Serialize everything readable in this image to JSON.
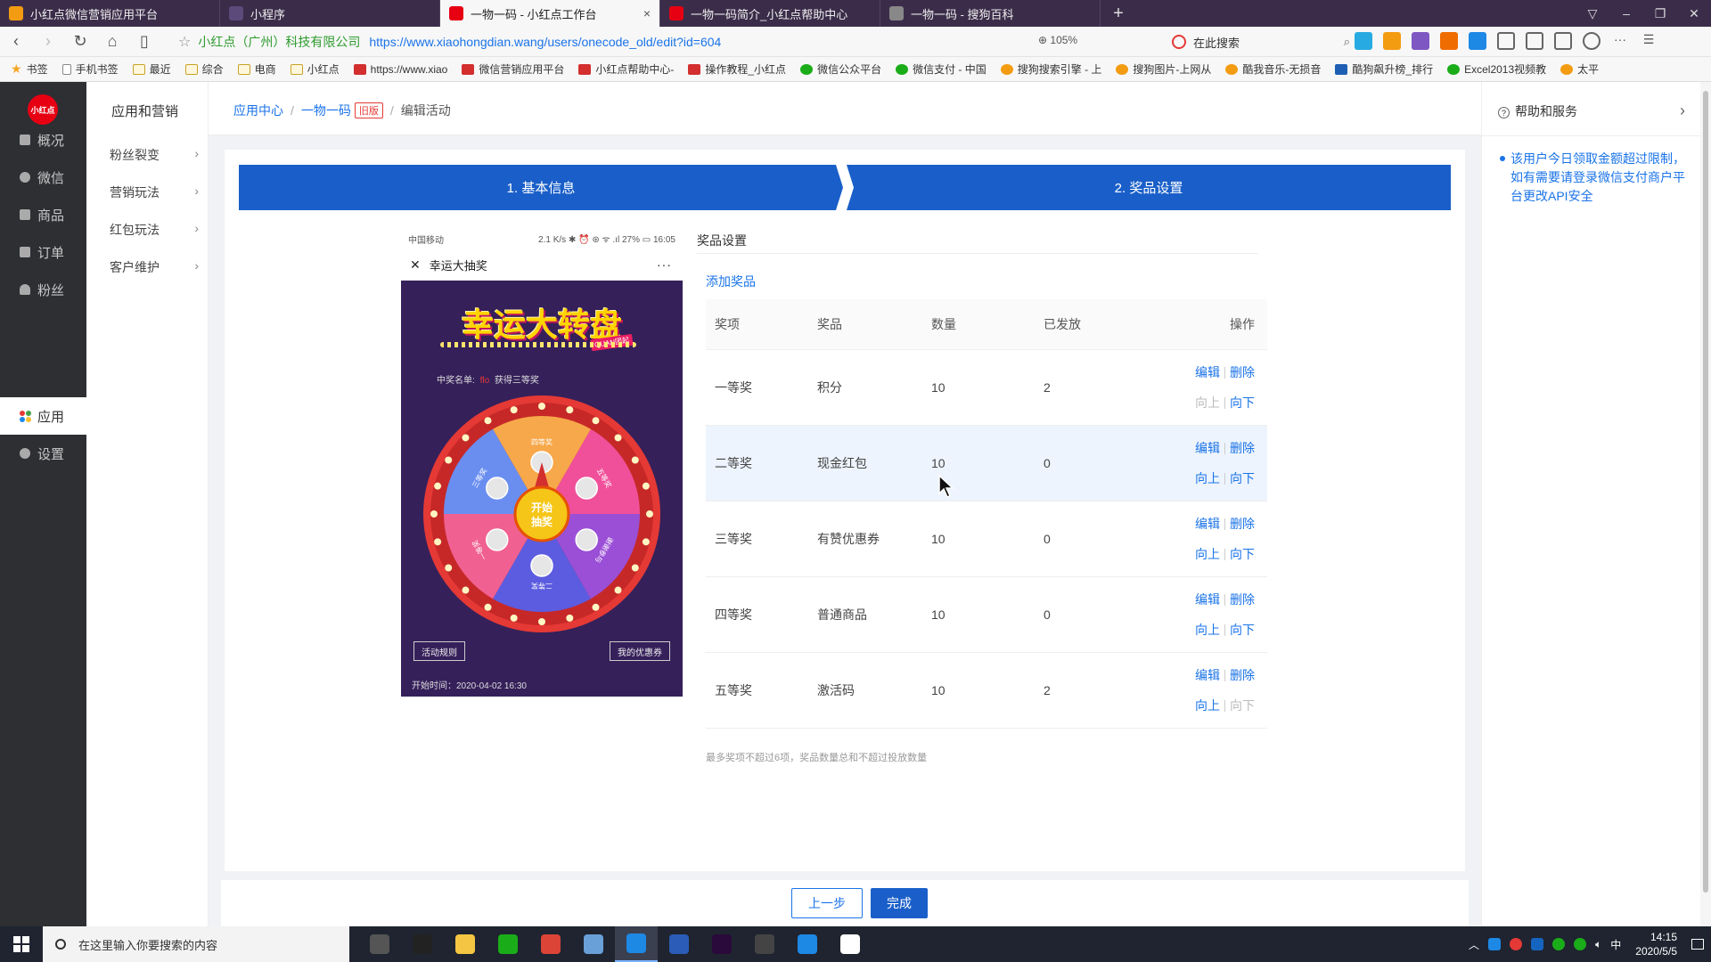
{
  "browser": {
    "tabs": [
      {
        "title": "小红点微信营销应用平台",
        "active": false,
        "icon": "monkey-icon",
        "color": "#f39c12"
      },
      {
        "title": "小程序",
        "active": false,
        "icon": "mini-program-icon",
        "color": "#5b4a7a"
      },
      {
        "title": "一物一码 - 小红点工作台",
        "active": true,
        "icon": "xiaohongdian-icon",
        "color": "#e60012"
      },
      {
        "title": "一物一码简介_小红点帮助中心",
        "active": false,
        "icon": "xiaohongdian-icon",
        "color": "#e60012"
      },
      {
        "title": "一物一码 - 搜狗百科",
        "active": false,
        "icon": "sogou-icon",
        "color": "#888888"
      }
    ],
    "tab_close": "×",
    "new_tab": "+",
    "org_name": "小红点（广州）科技有限公司",
    "url": "https://www.xiaohongdian.wang/users/onecode_old/edit?id=604",
    "zoom": "105%",
    "search_placeholder": "在此搜索",
    "bookmarks": [
      {
        "label": "书签",
        "type": "star"
      },
      {
        "label": "手机书签",
        "type": "page"
      },
      {
        "label": "最近",
        "type": "folder"
      },
      {
        "label": "综合",
        "type": "folder"
      },
      {
        "label": "电商",
        "type": "folder"
      },
      {
        "label": "小红点",
        "type": "folder"
      },
      {
        "label": "https://www.xiao",
        "type": "red"
      },
      {
        "label": "微信营销应用平台",
        "type": "red"
      },
      {
        "label": "小红点帮助中心-",
        "type": "red"
      },
      {
        "label": "操作教程_小红点",
        "type": "red"
      },
      {
        "label": "微信公众平台",
        "type": "green"
      },
      {
        "label": "微信支付 - 中国",
        "type": "green"
      },
      {
        "label": "搜狗搜索引擎 - 上",
        "type": "orange"
      },
      {
        "label": "搜狗图片-上网从",
        "type": "orange"
      },
      {
        "label": "酷我音乐-无损音",
        "type": "orange"
      },
      {
        "label": "酷狗飙升榜_排行",
        "type": "blue"
      },
      {
        "label": "Excel2013视频教",
        "type": "green"
      },
      {
        "label": "太平",
        "type": "orange"
      }
    ]
  },
  "sidebar": {
    "logo": "小红点",
    "items": [
      {
        "label": "概况",
        "icon": "dashboard-icon",
        "active": false
      },
      {
        "label": "微信",
        "icon": "wechat-icon",
        "active": false
      },
      {
        "label": "商品",
        "icon": "bag-icon",
        "active": false
      },
      {
        "label": "订单",
        "icon": "order-icon",
        "active": false
      },
      {
        "label": "粉丝",
        "icon": "user-icon",
        "active": false
      },
      {
        "label": "应用",
        "icon": "apps-icon",
        "active": true
      },
      {
        "label": "设置",
        "icon": "gear-icon",
        "active": false
      }
    ]
  },
  "subnav": {
    "title": "应用和营销",
    "items": [
      "粉丝裂变",
      "营销玩法",
      "红包玩法",
      "客户维护"
    ],
    "chevron": "›"
  },
  "breadcrumb": {
    "home": "应用中心",
    "section": "一物一码",
    "tag": "旧版",
    "current": "编辑活动",
    "sep": "/"
  },
  "steps": {
    "step1": "1. 基本信息",
    "step2": "2. 奖品设置"
  },
  "phone": {
    "carrier": "中国移动",
    "status_right": "2.1 K/s ✱ ⏰ ⊛ ᯤ .ıl 27% ▭ 16:05",
    "title": "幸运大抽奖",
    "close": "✕",
    "more": "···",
    "banner": "幸运大转盘",
    "banner_sub": "QUAN团起",
    "winners_label": "中奖名单:",
    "winners_name": "flo",
    "winners_text": "获得三等奖",
    "wheel_center": [
      "开始",
      "抽奖"
    ],
    "wheel_segments": [
      {
        "label": "四等奖",
        "color": "#f7a84a"
      },
      {
        "label": "五等奖",
        "color": "#f0509a"
      },
      {
        "label": "谢谢参与",
        "color": "#9b4fd6"
      },
      {
        "label": "二等奖",
        "color": "#5c5ce0"
      },
      {
        "label": "一等奖",
        "color": "#f06090"
      },
      {
        "label": "三等奖",
        "color": "#6a8ef0"
      }
    ],
    "rules_btn": "活动规则",
    "coupon_btn": "我的优惠券",
    "start_time": "开始时间：2020-04-02 16:30"
  },
  "prizes": {
    "section_title": "奖品设置",
    "add_link": "添加奖品",
    "columns": [
      "奖项",
      "奖品",
      "数量",
      "已发放",
      "操作"
    ],
    "rows": [
      {
        "level": "一等奖",
        "prize": "积分",
        "qty": "10",
        "issued": "2",
        "up_disabled": true,
        "down_disabled": false
      },
      {
        "level": "二等奖",
        "prize": "现金红包",
        "qty": "10",
        "issued": "0",
        "up_disabled": false,
        "down_disabled": false
      },
      {
        "level": "三等奖",
        "prize": "有赞优惠券",
        "qty": "10",
        "issued": "0",
        "up_disabled": false,
        "down_disabled": false
      },
      {
        "level": "四等奖",
        "prize": "普通商品",
        "qty": "10",
        "issued": "0",
        "up_disabled": false,
        "down_disabled": false
      },
      {
        "level": "五等奖",
        "prize": "激活码",
        "qty": "10",
        "issued": "2",
        "up_disabled": false,
        "down_disabled": true
      }
    ],
    "op_edit": "编辑",
    "op_delete": "删除",
    "op_up": "向上",
    "op_down": "向下",
    "hint": "最多奖项不超过6项，奖品数量总和不超过投放数量"
  },
  "footer": {
    "prev": "上一步",
    "done": "完成"
  },
  "help": {
    "title": "帮助和服务",
    "chevron": "›",
    "text": "该用户今日领取金额超过限制，如有需要请登录微信支付商户平台更改API安全"
  },
  "taskbar": {
    "search_placeholder": "在这里输入你要搜索的内容",
    "apps": [
      {
        "icon": "calculator-icon",
        "color": "#555555"
      },
      {
        "icon": "qq-icon",
        "color": "#222222"
      },
      {
        "icon": "file-explorer-icon",
        "color": "#f4c542"
      },
      {
        "icon": "wechat-icon",
        "color": "#1aad19"
      },
      {
        "icon": "chrome-icon",
        "color": "#db4437"
      },
      {
        "icon": "notepad-icon",
        "color": "#6aa0d8"
      },
      {
        "icon": "browser-icon",
        "color": "#1e88e5"
      },
      {
        "icon": "word-icon",
        "color": "#2b5cb8"
      },
      {
        "icon": "premiere-icon",
        "color": "#2a0a3a"
      },
      {
        "icon": "obs-icon",
        "color": "#444444"
      },
      {
        "icon": "app-icon",
        "color": "#1e88e5"
      },
      {
        "icon": "screenshot-icon",
        "color": "#ffffff"
      }
    ],
    "ime": "中",
    "time": "14:15",
    "date": "2020/5/5"
  }
}
